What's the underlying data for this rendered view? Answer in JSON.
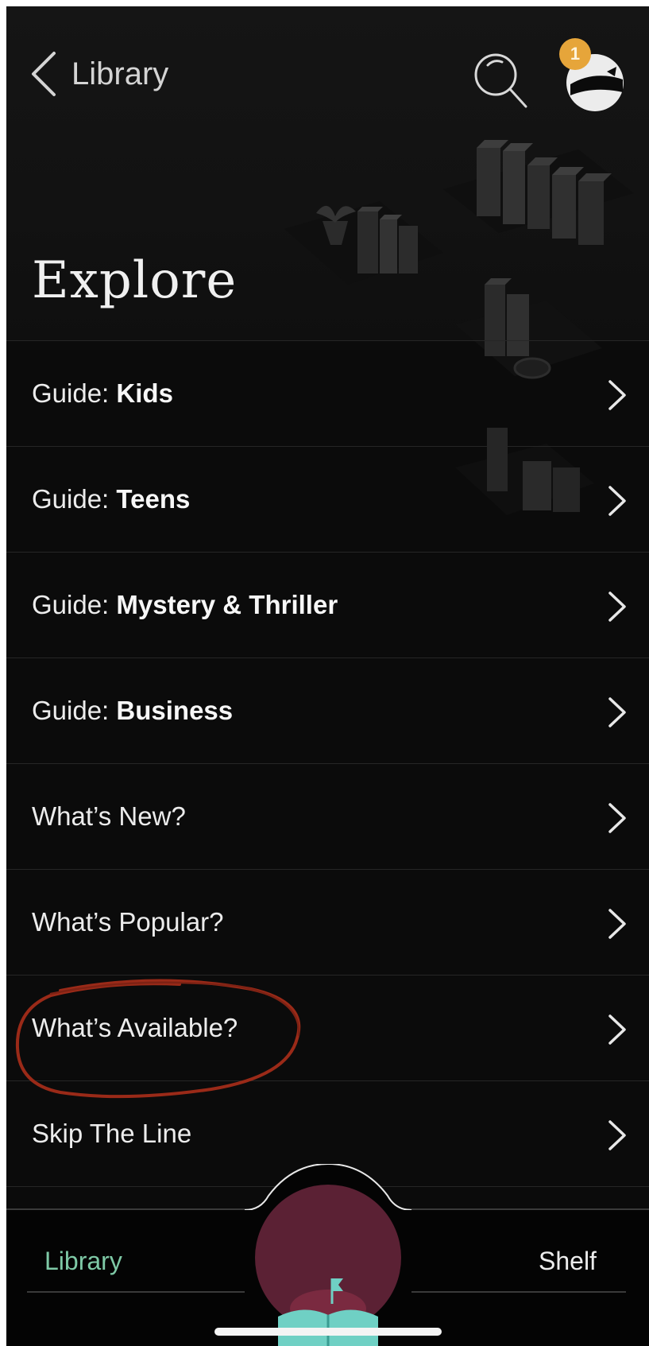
{
  "header": {
    "back_label": "Library",
    "title": "Explore",
    "notification_count": "1"
  },
  "menu": {
    "items": [
      {
        "prefix": "Guide: ",
        "emphasis": "Kids"
      },
      {
        "prefix": "Guide: ",
        "emphasis": "Teens"
      },
      {
        "prefix": "Guide: ",
        "emphasis": "Mystery & Thriller"
      },
      {
        "prefix": "Guide: ",
        "emphasis": "Business"
      },
      {
        "prefix": "What’s New?",
        "emphasis": ""
      },
      {
        "prefix": "What’s Popular?",
        "emphasis": ""
      },
      {
        "prefix": "What’s Available?",
        "emphasis": ""
      },
      {
        "prefix": "Skip The Line",
        "emphasis": ""
      }
    ]
  },
  "tabbar": {
    "library_label": "Library",
    "shelf_label": "Shelf"
  },
  "colors": {
    "background": "#0b0b0b",
    "accent_green": "#7ec9a6",
    "badge": "#e6a53a",
    "fab": "#5b2134",
    "annotation": "#9a2a18"
  },
  "icons": {
    "back": "chevron-left-icon",
    "search": "search-icon",
    "avatar": "avatar-icon",
    "row_chevron": "chevron-right-icon",
    "fab": "open-book-icon"
  }
}
